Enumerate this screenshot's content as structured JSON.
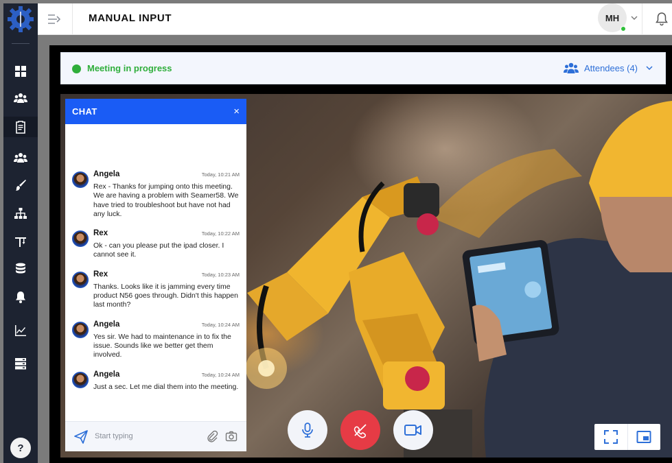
{
  "header": {
    "title": "MANUAL INPUT",
    "user_initials": "MH"
  },
  "meeting": {
    "status": "Meeting in progress",
    "attendees_label": "Attendees (4)"
  },
  "chat": {
    "title": "CHAT",
    "close": "×",
    "input_placeholder": "Start typing",
    "messages": [
      {
        "name": "Angela",
        "time": "Today, 10:21 AM",
        "text": "Rex - Thanks for jumping onto this meeting. We are having a problem with Seamer58. We have tried to troubleshoot but have not had any luck."
      },
      {
        "name": "Rex",
        "time": "Today, 10:22 AM",
        "text": "Ok - can you please put the ipad closer. I cannot see it."
      },
      {
        "name": "Rex",
        "time": "Today, 10:23 AM",
        "text": "Thanks. Looks like it is jamming every time product N56 goes through. Didn't this happen last month?"
      },
      {
        "name": "Angela",
        "time": "Today, 10:24 AM",
        "text": "Yes sir. We had to maintenance in to fix the issue. Sounds like we better get them involved."
      },
      {
        "name": "Angela",
        "time": "Today, 10:24 AM",
        "text": "Just a sec. Let me dial them into the meeting."
      }
    ]
  },
  "sidebar": {
    "icons": [
      "dashboard-icon",
      "users-icon",
      "clipboard-icon",
      "team-icon",
      "brush-icon",
      "hierarchy-icon",
      "crane-icon",
      "database-icon",
      "bell-icon",
      "chart-icon",
      "server-icon"
    ],
    "help": "?"
  },
  "colors": {
    "sidebar": "#1d2331",
    "accent": "#1a5cf5",
    "status": "#2fae3b",
    "end_call": "#e63b45"
  }
}
